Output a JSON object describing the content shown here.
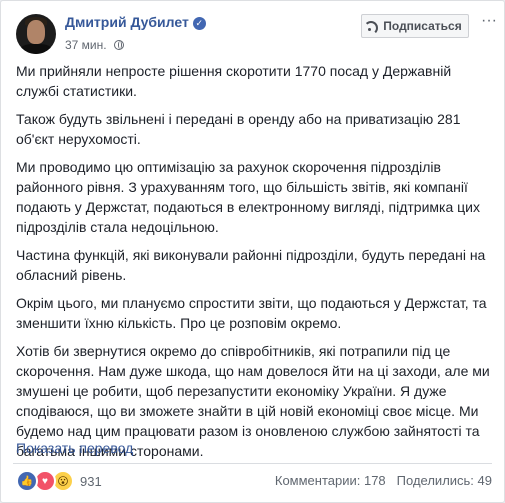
{
  "post": {
    "author": "Дмитрий Дубилет",
    "time": "37 мин.",
    "follow_label": "Подписаться",
    "paragraphs": [
      "Ми прийняли непросте рішення скоротити 1770 посад у Державній службі статистики.",
      "Також будуть звільнені і передані в оренду або на приватизацію 281 об'єкт нерухомості.",
      "Ми проводимо цю оптимізацію за рахунок скорочення підрозділів районного рівня. З урахуванням того, що більшість звітів, які компанії подають у Держстат, подаються в електронному вигляді, підтримка цих підрозділів стала недоцільною.",
      "Частина функцій, які виконували районні підрозділи, будуть передані на обласний рівень.",
      "Окрім цього, ми плануємо спростити звіти, що подаються у Держстат, та зменшити їхню кількість. Про це розповім окремо.",
      "Хотів би звернутися окремо до співробітників, які потрапили під це скорочення. Нам дуже шкода, що нам довелося йти на ці заходи, але ми змушені це робити, щоб перезапустити економіку України. Я дуже сподіваюся, що ви зможете знайти в цій новій економіці своє місце. Ми будемо над цим працювати разом із оновленою службою зайнятості та багатьма іншими сторонами."
    ],
    "translate_label": "Показать перевод"
  },
  "footer": {
    "reaction_count": "931",
    "comments_label": "Комментарии: 178",
    "shares_label": "Поделились: 49"
  },
  "icons": {
    "verified": "verified-badge-icon",
    "audience": "globe-icon",
    "follow": "rss-icon",
    "more": "more-dots-icon",
    "reactions": [
      "like-icon",
      "love-icon",
      "wow-icon"
    ]
  },
  "colors": {
    "link": "#365899",
    "accent": "#4267b2",
    "love": "#f25268",
    "wow": "#fcd04a"
  }
}
